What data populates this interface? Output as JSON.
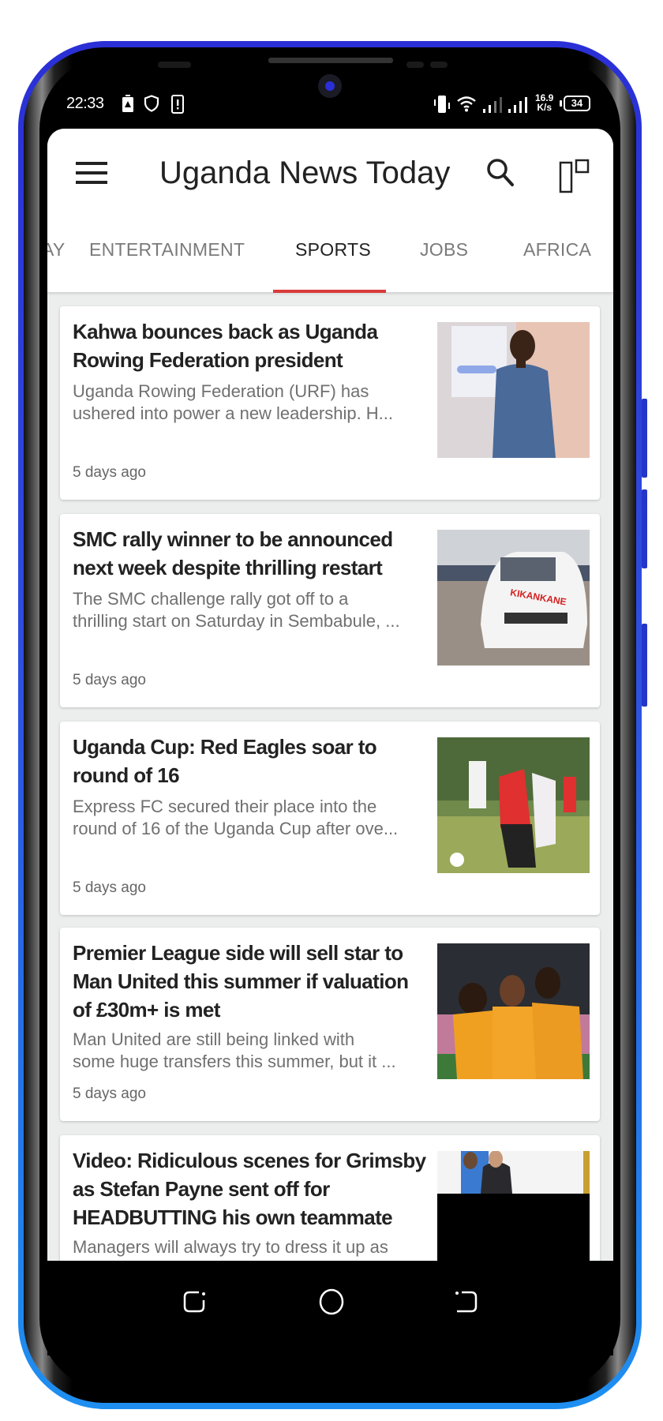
{
  "status_bar": {
    "time": "22:33",
    "left_icons": [
      "battery-alert-icon",
      "shield-icon",
      "phone-alert-icon"
    ],
    "right_icons": [
      "vibrate-icon",
      "wifi-icon",
      "signal-1-icon",
      "signal-2-icon"
    ],
    "net_speed_value": "16.9",
    "net_speed_unit": "K/s",
    "battery_level": "34"
  },
  "app_bar": {
    "title": "Uganda News Today",
    "menu_icon": "hamburger-menu-icon",
    "search_icon": "search-icon",
    "layout_icon": "layout-toggle-icon"
  },
  "tabs": [
    {
      "label": "AY",
      "active": false
    },
    {
      "label": "ENTERTAINMENT",
      "active": false
    },
    {
      "label": "SPORTS",
      "active": true
    },
    {
      "label": "JOBS",
      "active": false
    },
    {
      "label": "AFRICA",
      "active": false
    }
  ],
  "accent_color": "#d93a3a",
  "articles": [
    {
      "title": "Kahwa bounces back as Uganda Rowing Federation president",
      "summary_line1": "Uganda Rowing Federation (URF) has",
      "summary_line2": "ushered into power a new leadership. H...",
      "time": "5 days ago",
      "image": "man in blue shirt presenting"
    },
    {
      "title": "SMC rally winner to be announced next week despite thrilling restart",
      "summary_line1": "The SMC challenge rally got off to a",
      "summary_line2": "thrilling start on Saturday in Sembabule, ...",
      "time": "5 days ago",
      "image": "white rally car KIKANKANE"
    },
    {
      "title": "Uganda Cup: Red Eagles soar to round of 16",
      "summary_line1": "Express FC secured their place into the",
      "summary_line2": "round of 16 of the Uganda Cup after ove...",
      "time": "5 days ago",
      "image": "football players tackling"
    },
    {
      "title": "Premier League side will sell star to Man United this summer if valuation of £30m+ is met",
      "summary_line1": "Man United are still being linked with",
      "summary_line2": "some huge transfers this summer, but it ...",
      "time": "5 days ago",
      "image": "players in orange celebrating"
    },
    {
      "title": "Video: Ridiculous scenes for Grimsby as Stefan Payne sent off for HEADBUTTING his own teammate",
      "summary_line1": "Managers will always try to dress it up as",
      "summary_line2": "",
      "time": "",
      "image": "two men, partially loaded"
    }
  ],
  "nav_bar": {
    "recents": "recents-icon",
    "home": "home-icon",
    "back": "back-icon"
  }
}
